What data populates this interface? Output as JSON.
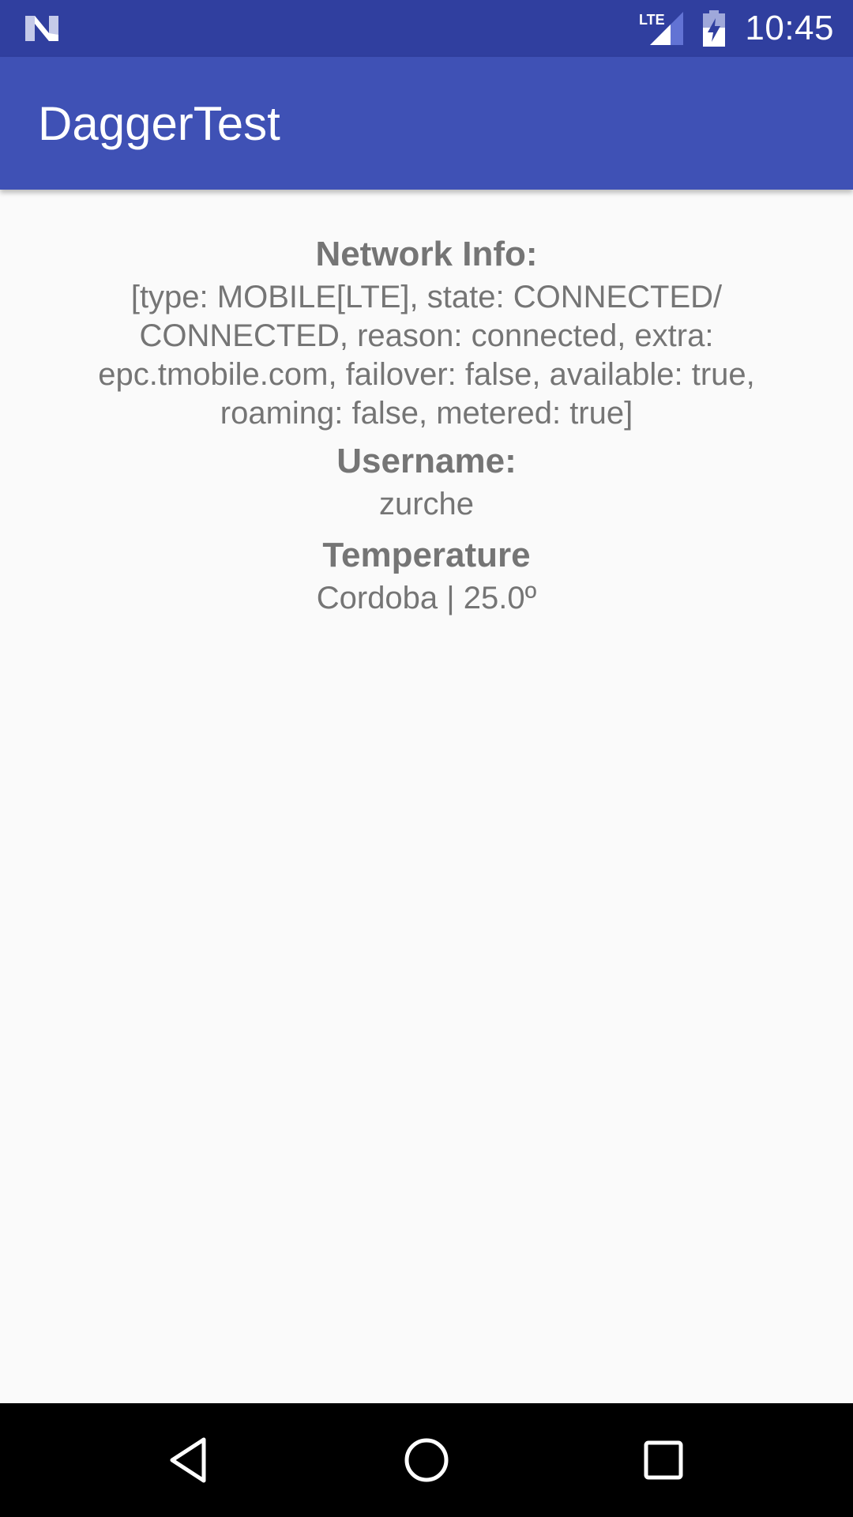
{
  "status_bar": {
    "time": "10:45",
    "network_label": "LTE",
    "left_icon": "android-n-logo-icon",
    "icons": [
      "lte-signal-icon",
      "battery-charging-icon"
    ]
  },
  "app_bar": {
    "title": "DaggerTest",
    "color": "#3f51b5"
  },
  "content": {
    "network": {
      "label": "Network Info:",
      "value": "[type: MOBILE[LTE], state: CONNECTED/ CONNECTED, reason: connected, extra: epc.tmobile.com, failover: false, available: true, roaming: false, metered: true]"
    },
    "username": {
      "label": "Username:",
      "value": "zurche"
    },
    "temperature": {
      "label": "Temperature",
      "value": "Cordoba | 25.0º"
    }
  },
  "nav_bar": {
    "buttons": [
      "back-icon",
      "home-icon",
      "recents-icon"
    ]
  }
}
